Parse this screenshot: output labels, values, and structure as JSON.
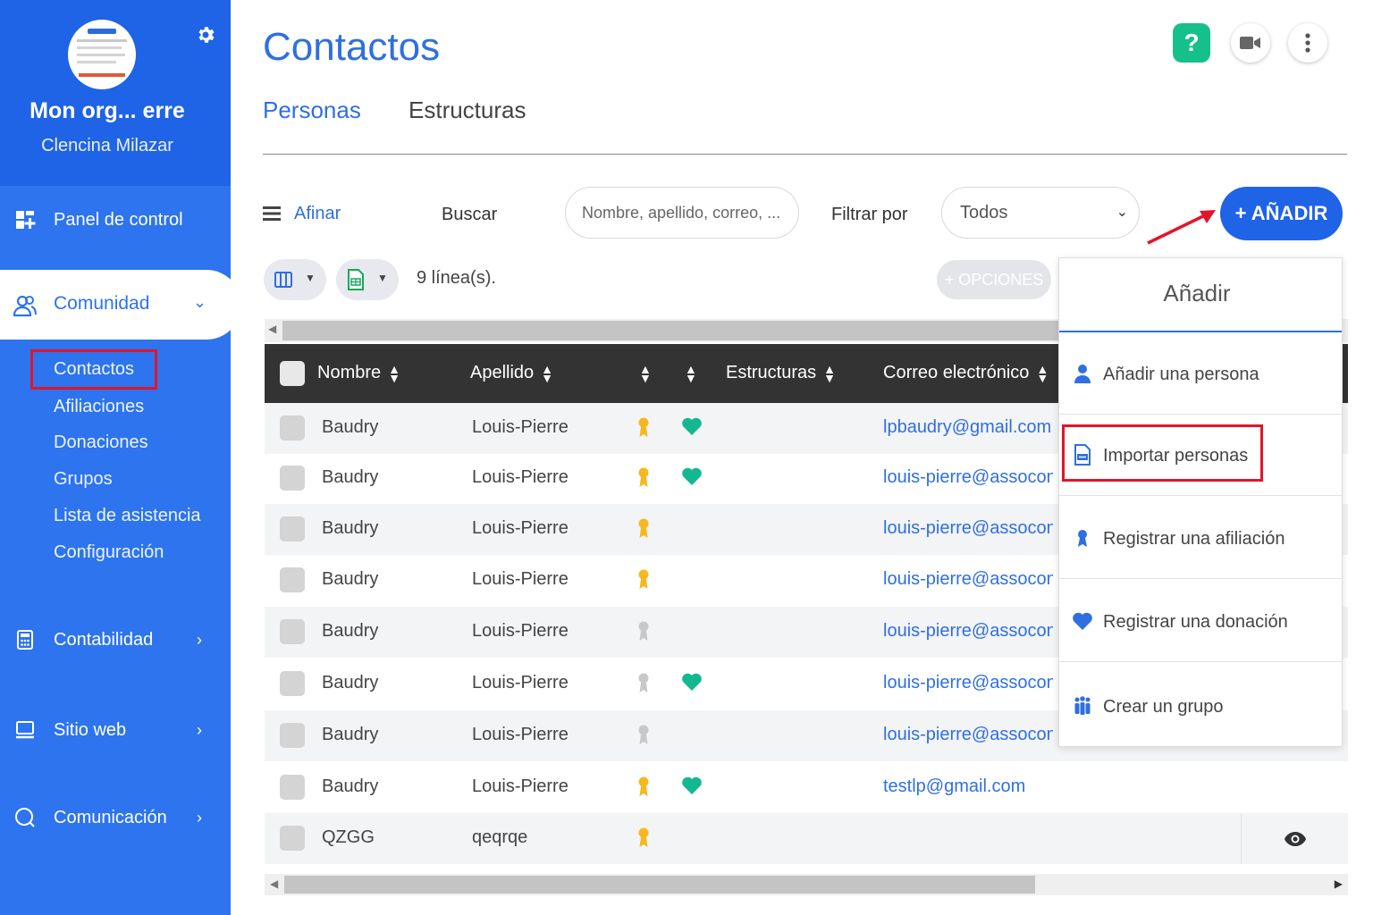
{
  "sidebar": {
    "org_name": "Mon org... erre",
    "user_name": "Clencina Milazar",
    "nav": [
      {
        "label": "Panel de control",
        "icon": "dashboard-icon"
      },
      {
        "label": "Comunidad",
        "icon": "people-icon"
      },
      {
        "label": "Contabilidad",
        "icon": "calculator-icon"
      },
      {
        "label": "Sitio web",
        "icon": "monitor-icon"
      },
      {
        "label": "Comunicación",
        "icon": "chat-icon"
      }
    ],
    "community_sub": [
      "Contactos",
      "Afiliaciones",
      "Donaciones",
      "Grupos",
      "Lista de asistencia",
      "Configuración"
    ]
  },
  "page": {
    "title": "Contactos",
    "tabs": [
      "Personas",
      "Estructuras"
    ],
    "active_tab": "Personas"
  },
  "toolbar": {
    "afinar": "Afinar",
    "buscar": "Buscar",
    "search_placeholder": "Nombre, apellido, correo, ...",
    "filtrar": "Filtrar por",
    "filter_value": "Todos",
    "add_button": "+ AÑADIR",
    "lines_count": "9 línea(s).",
    "options_button": "+ OPCIONES"
  },
  "table": {
    "headers": [
      "Nombre",
      "Apellido",
      "Estructuras",
      "Correo electrónico"
    ],
    "rows": [
      {
        "name": "Baudry",
        "last": "Louis-Pierre",
        "ribbon": "gold",
        "heart": true,
        "email": "lpbaudry@gmail.com"
      },
      {
        "name": "Baudry",
        "last": "Louis-Pierre",
        "ribbon": "gold",
        "heart": true,
        "email": "louis-pierre@assoconnect.com"
      },
      {
        "name": "Baudry",
        "last": "Louis-Pierre",
        "ribbon": "gold",
        "heart": false,
        "email": "louis-pierre@assoconnect.com"
      },
      {
        "name": "Baudry",
        "last": "Louis-Pierre",
        "ribbon": "gold",
        "heart": false,
        "email": "louis-pierre@assoconnect.com"
      },
      {
        "name": "Baudry",
        "last": "Louis-Pierre",
        "ribbon": "grey",
        "heart": false,
        "email": "louis-pierre@assoconnect.com"
      },
      {
        "name": "Baudry",
        "last": "Louis-Pierre",
        "ribbon": "grey",
        "heart": true,
        "email": "louis-pierre@assoconnect.com"
      },
      {
        "name": "Baudry",
        "last": "Louis-Pierre",
        "ribbon": "grey",
        "heart": false,
        "email": "louis-pierre@assoconnect.com"
      },
      {
        "name": "Baudry",
        "last": "Louis-Pierre",
        "ribbon": "gold",
        "heart": true,
        "email": "testlp@gmail.com"
      },
      {
        "name": "QZGG",
        "last": "qeqrqe",
        "ribbon": "gold",
        "heart": false,
        "email": ""
      }
    ]
  },
  "add_menu": {
    "title": "Añadir",
    "items": [
      {
        "label": "Añadir una persona",
        "icon": "person-icon"
      },
      {
        "label": "Importar personas",
        "icon": "import-file-icon"
      },
      {
        "label": "Registrar una afiliación",
        "icon": "ribbon-icon"
      },
      {
        "label": "Registrar una donación",
        "icon": "heart-icon"
      },
      {
        "label": "Crear un grupo",
        "icon": "group-icon"
      }
    ]
  },
  "colors": {
    "sidebar": "#2d74ee",
    "accent": "#2f6fe2",
    "primary_button": "#1f63e6",
    "help": "#16c08a",
    "heart": "#14b890",
    "ribbon_gold": "#f5b820",
    "ribbon_grey": "#c8c8c8",
    "highlight": "#e3142a"
  }
}
